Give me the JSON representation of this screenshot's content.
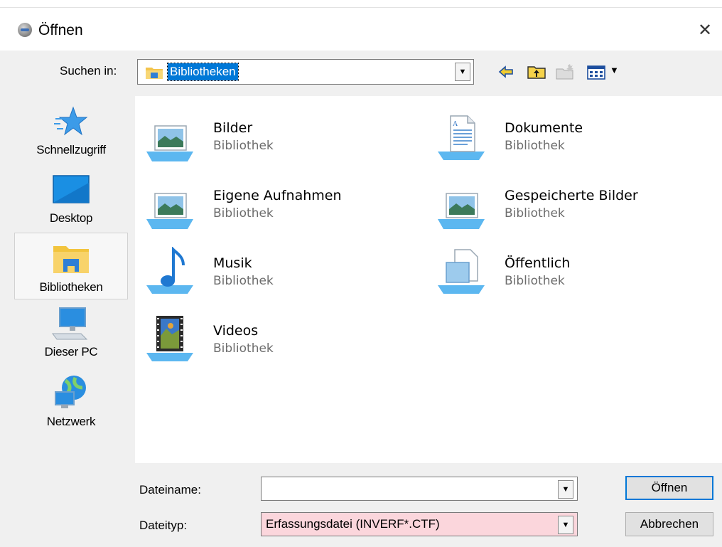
{
  "window": {
    "title": "Öffnen",
    "close_glyph": "✕"
  },
  "lookin": {
    "label": "Suchen in:",
    "value": "Bibliotheken",
    "dropdown_glyph": "▼"
  },
  "toolbar": {
    "back_icon": "back-arrow-icon",
    "up_icon": "folder-up-icon",
    "new_folder_icon": "new-folder-icon",
    "view_menu_icon": "view-menu-icon",
    "view_caret": "▼"
  },
  "places": [
    {
      "label": "Schnellzugriff",
      "icon": "star-icon"
    },
    {
      "label": "Desktop",
      "icon": "desktop-icon"
    },
    {
      "label": "Bibliotheken",
      "icon": "libraries-icon",
      "selected": true
    },
    {
      "label": "Dieser PC",
      "icon": "computer-icon"
    },
    {
      "label": "Netzwerk",
      "icon": "network-icon"
    }
  ],
  "items": [
    {
      "name": "Bilder",
      "type": "Bibliothek",
      "icon": "pictures-library-icon"
    },
    {
      "name": "Dokumente",
      "type": "Bibliothek",
      "icon": "documents-library-icon"
    },
    {
      "name": "Eigene Aufnahmen",
      "type": "Bibliothek",
      "icon": "camera-roll-library-icon"
    },
    {
      "name": "Gespeicherte Bilder",
      "type": "Bibliothek",
      "icon": "saved-pictures-library-icon"
    },
    {
      "name": "Musik",
      "type": "Bibliothek",
      "icon": "music-library-icon"
    },
    {
      "name": "Öffentlich",
      "type": "Bibliothek",
      "icon": "public-library-icon"
    },
    {
      "name": "Videos",
      "type": "Bibliothek",
      "icon": "videos-library-icon"
    }
  ],
  "filename": {
    "label": "Dateiname:",
    "value": "",
    "dropdown_glyph": "▼"
  },
  "filetype": {
    "label": "Dateityp:",
    "value": "Erfassungsdatei (INVERF*.CTF)",
    "dropdown_glyph": "▼",
    "highlight_color": "#fbd6dc"
  },
  "buttons": {
    "open": "Öffnen",
    "cancel": "Abbrechen"
  },
  "colors": {
    "selection": "#0078d7",
    "secondary_text": "#6d6d6d"
  }
}
